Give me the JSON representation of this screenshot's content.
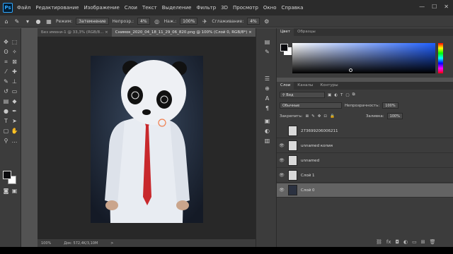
{
  "app": {
    "logo_text": "Ps"
  },
  "menu": [
    "Файл",
    "Редактирование",
    "Изображение",
    "Слои",
    "Текст",
    "Выделение",
    "Фильтр",
    "3D",
    "Просмотр",
    "Окно",
    "Справка"
  ],
  "window_buttons": {
    "minimize": "—",
    "maximize": "☐",
    "close": "✕"
  },
  "options_bar": {
    "mode_label": "Режим:",
    "mode_value": "Затемнение",
    "opacity_label": "Непрозр.:",
    "opacity_value": "4%",
    "pressure_label": "Наж.:",
    "pressure_value": "100%",
    "smoothing_label": "Сглаживание:",
    "smoothing_value": "4%"
  },
  "documents": {
    "tabs": [
      {
        "label": "Без имени-1 @ 33,3% (RGB/8...",
        "close": "×"
      },
      {
        "label": "Снимок_2020_04_18_11_29_06_820.png @ 100% (Слой 0, RGB/8*)",
        "close": "×"
      }
    ]
  },
  "status_bar": {
    "zoom": "100%",
    "doc_info": "Док: 572,4K/3,10M",
    "arrow": ">"
  },
  "color_panel": {
    "tabs": [
      "Цвет",
      "Образцы"
    ],
    "foreground": "#0b0b0e",
    "background": "#ffffff",
    "hue_base": "#1f5fff"
  },
  "layers_panel": {
    "tabs": [
      "Слои",
      "Каналы",
      "Контуры"
    ],
    "filter_label": "Вид",
    "blend_mode": "Обычные",
    "opacity_label": "Непрозрачность:",
    "opacity_value": "100%",
    "lock_label": "Закрепить:",
    "fill_label": "Заливка:",
    "fill_value": "100%",
    "layers": [
      {
        "name": "273699206006211",
        "visible": false,
        "selected": false
      },
      {
        "name": "unnamed копия",
        "visible": true,
        "selected": false
      },
      {
        "name": "unnamed",
        "visible": true,
        "selected": false
      },
      {
        "name": "Слой 1",
        "visible": true,
        "selected": false
      },
      {
        "name": "Слой 0",
        "visible": true,
        "selected": true
      }
    ],
    "eye_glyph": "👁"
  },
  "icons": [
    "move-icon",
    "marquee-icon",
    "lasso-icon",
    "magic-wand-icon",
    "crop-icon",
    "eyedropper-icon",
    "healing-icon",
    "brush-icon",
    "stamp-icon",
    "history-brush-icon",
    "eraser-icon",
    "gradient-icon",
    "blur-icon",
    "dodge-icon",
    "pen-icon",
    "type-icon",
    "path-select-icon",
    "shape-icon",
    "hand-icon",
    "zoom-icon"
  ]
}
